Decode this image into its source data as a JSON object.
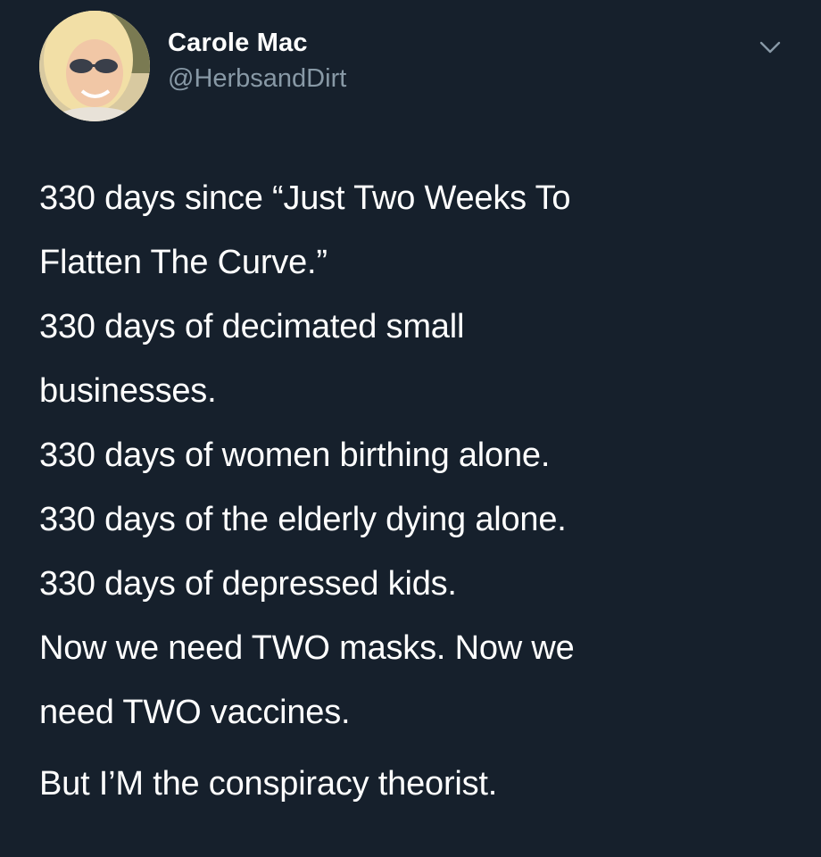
{
  "author": {
    "display_name": "Carole Mac",
    "handle": "@HerbsandDirt"
  },
  "menu": {
    "icon": "chevron-down-icon"
  },
  "tweet": {
    "lines": [
      "330 days since “Just Two Weeks To",
      "Flatten The Curve.”",
      "330 days of decimated small",
      "businesses.",
      "330 days of women birthing alone.",
      "330 days of the elderly dying alone.",
      "330 days of depressed kids.",
      "Now we need TWO masks. Now we",
      "need TWO vaccines."
    ],
    "closing": "But I’M the conspiracy theorist."
  },
  "colors": {
    "background": "#16202c",
    "text": "#ffffff",
    "secondary_text": "#8899a6"
  }
}
